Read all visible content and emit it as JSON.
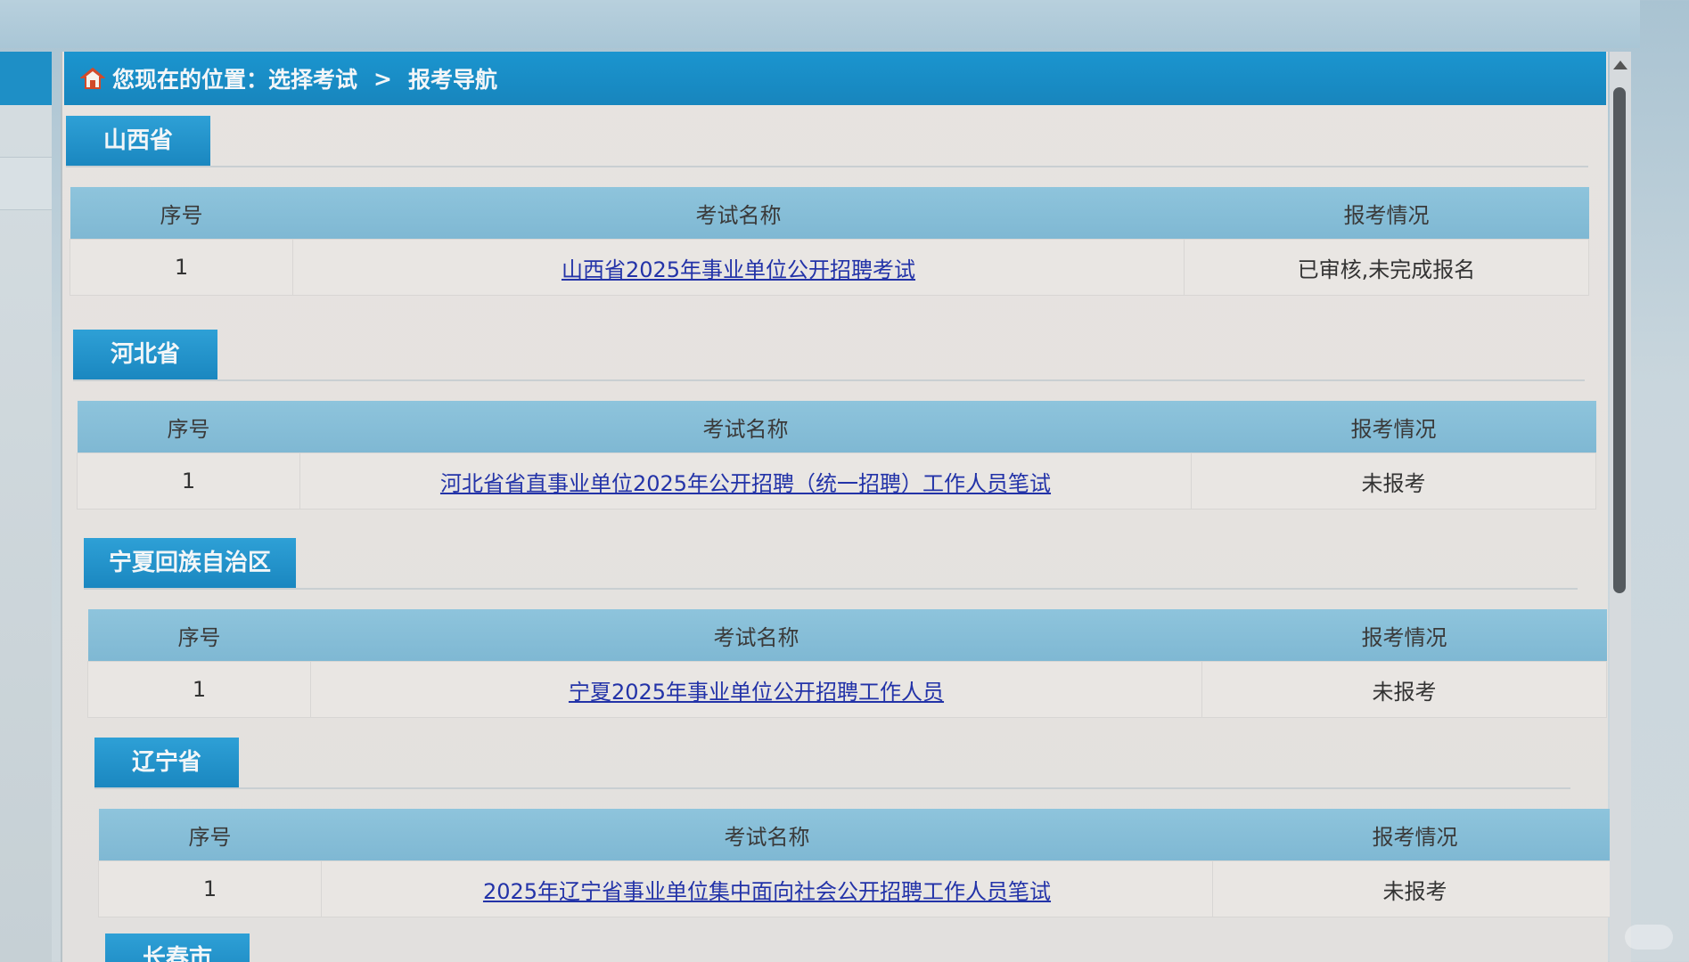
{
  "breadcrumb": {
    "prefix": "您现在的位置：",
    "items": [
      "选择考试",
      "报考导航"
    ],
    "separator": ">"
  },
  "table_headers": {
    "no": "序号",
    "name": "考试名称",
    "status": "报考情况"
  },
  "sections": [
    {
      "province": "山西省",
      "rows": [
        {
          "no": "1",
          "name": "山西省2025年事业单位公开招聘考试",
          "status": "已审核,未完成报名"
        }
      ]
    },
    {
      "province": "河北省",
      "rows": [
        {
          "no": "1",
          "name": "河北省省直事业单位2025年公开招聘（统一招聘）工作人员笔试",
          "status": "未报考"
        }
      ]
    },
    {
      "province": "宁夏回族自治区",
      "rows": [
        {
          "no": "1",
          "name": "宁夏2025年事业单位公开招聘工作人员",
          "status": "未报考"
        }
      ]
    },
    {
      "province": "辽宁省",
      "rows": [
        {
          "no": "1",
          "name": "2025年辽宁省事业单位集中面向社会公开招聘工作人员笔试",
          "status": "未报考"
        }
      ]
    },
    {
      "province": "长春市",
      "rows": []
    }
  ],
  "colors": {
    "accent": "#1b95cf",
    "header_row": "#8ec4dc",
    "link": "#2333a8"
  }
}
